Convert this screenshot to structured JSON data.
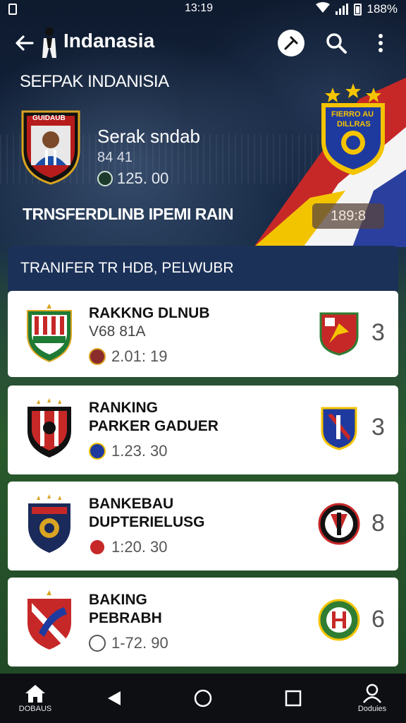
{
  "status_bar": {
    "time": "13:19",
    "battery": "188%"
  },
  "app_bar": {
    "title": "Indanasia"
  },
  "hero": {
    "title": "SEFPAK INDANISIA",
    "player_name": "Serak sndab",
    "player_number": "84 41",
    "player_value": "125. 00",
    "left_crest_text": "GUIDAUB",
    "right_crest_text_1": "FIERRO AU",
    "right_crest_text_2": "DILLRAS",
    "transfer_label": "TRNSFERDLINB IPEMI RAIN",
    "score": "189:8"
  },
  "section_title": "TRANIFER TR HDB, PELWUBR",
  "cards": [
    {
      "line1": "RAKKNG DLNUB",
      "line2": "V68 81A",
      "line2_light": true,
      "value": "2.01: 19",
      "rank": "3"
    },
    {
      "line1": "RANKING",
      "line2": "PARKER GADUER",
      "line2_light": false,
      "value": "1.23. 30",
      "rank": "3"
    },
    {
      "line1": "BANKEBAU",
      "line2": "DUPTERIELUSG",
      "line2_light": false,
      "value": "1:20. 30",
      "rank": "8"
    },
    {
      "line1": "BAKING",
      "line2": "PEBRABH",
      "line2_light": false,
      "value": "1-72. 90",
      "rank": "6"
    }
  ],
  "nav": {
    "home_label": "DOBAUS",
    "profile_label": "Doduies"
  },
  "colors": {
    "section_header": "#1b3158",
    "card_bg": "#ffffff",
    "navbar": "#0d0f13"
  }
}
